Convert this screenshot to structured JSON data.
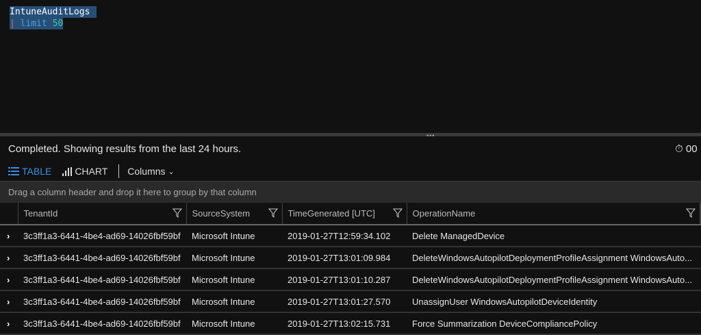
{
  "editor": {
    "line1": "IntuneAuditLogs",
    "pipe": "|",
    "keyword": "limit",
    "number": "50"
  },
  "status": {
    "text": "Completed. Showing results from the last 24 hours.",
    "timer": "00"
  },
  "toolbar": {
    "table": "TABLE",
    "chart": "CHART",
    "columns": "Columns"
  },
  "group_hint": "Drag a column header and drop it here to group by that column",
  "columns": [
    "TenantId",
    "SourceSystem",
    "TimeGenerated [UTC]",
    "OperationName"
  ],
  "rows": [
    [
      "3c3ff1a3-6441-4be4-ad69-14026fbf59bf",
      "Microsoft Intune",
      "2019-01-27T12:59:34.102",
      "Delete ManagedDevice"
    ],
    [
      "3c3ff1a3-6441-4be4-ad69-14026fbf59bf",
      "Microsoft Intune",
      "2019-01-27T13:01:09.984",
      "DeleteWindowsAutopilotDeploymentProfileAssignment WindowsAuto..."
    ],
    [
      "3c3ff1a3-6441-4be4-ad69-14026fbf59bf",
      "Microsoft Intune",
      "2019-01-27T13:01:10.287",
      "DeleteWindowsAutopilotDeploymentProfileAssignment WindowsAuto..."
    ],
    [
      "3c3ff1a3-6441-4be4-ad69-14026fbf59bf",
      "Microsoft Intune",
      "2019-01-27T13:01:27.570",
      "UnassignUser WindowsAutopilotDeviceIdentity"
    ],
    [
      "3c3ff1a3-6441-4be4-ad69-14026fbf59bf",
      "Microsoft Intune",
      "2019-01-27T13:02:15.731",
      "Force Summarization DeviceCompliancePolicy"
    ]
  ]
}
